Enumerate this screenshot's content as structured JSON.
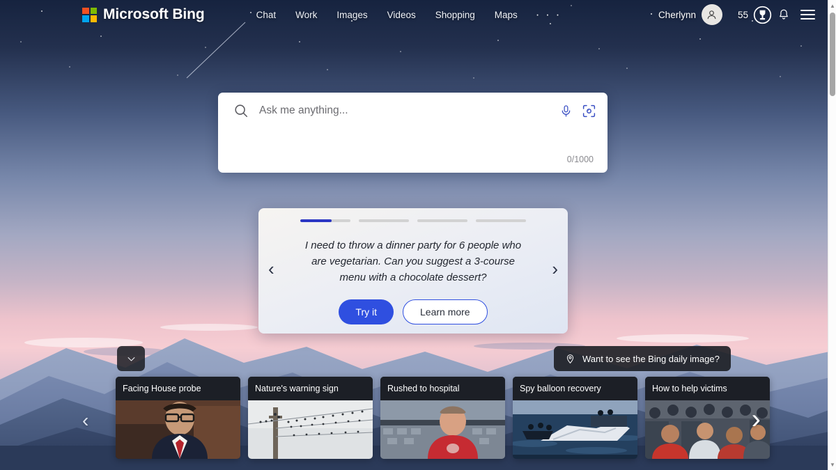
{
  "brand": {
    "name": "Microsoft Bing",
    "logo_icon": "microsoft-logo-icon",
    "colors": {
      "red": "#f25022",
      "green": "#7fba00",
      "blue": "#00a4ef",
      "yellow": "#ffb900"
    }
  },
  "nav": {
    "items": [
      {
        "label": "Chat"
      },
      {
        "label": "Work"
      },
      {
        "label": "Images"
      },
      {
        "label": "Videos"
      },
      {
        "label": "Shopping"
      },
      {
        "label": "Maps"
      }
    ],
    "more_label": "· · ·"
  },
  "account": {
    "username": "Cherlynn",
    "avatar_icon": "person-avatar-icon",
    "rewards_count": "55",
    "rewards_icon": "rewards-trophy-icon",
    "notifications_icon": "bell-icon",
    "menu_icon": "hamburger-menu-icon"
  },
  "search": {
    "placeholder": "Ask me anything...",
    "value": "",
    "counter": "0/1000",
    "search_icon": "search-icon",
    "mic_icon": "microphone-icon",
    "lens_icon": "visual-search-icon",
    "accent": "#3a4fc4"
  },
  "suggestion_card": {
    "progress": {
      "total": 4,
      "active_index": 0,
      "active_fill_percent": 62
    },
    "prompt": "I need to throw a dinner party for 6 people who are vegetarian. Can you suggest a 3-course menu with a chocolate dessert?",
    "primary_button": "Try it",
    "secondary_button": "Learn more",
    "prev_icon": "chevron-left-icon",
    "next_icon": "chevron-right-icon",
    "primary_color": "#2f4fe0"
  },
  "controls": {
    "expand_icon": "chevron-down-icon",
    "daily_image_label": "Want to see the Bing daily image?",
    "daily_image_icon": "location-pin-icon",
    "news_prev_icon": "chevron-left-icon",
    "news_next_icon": "chevron-right-icon"
  },
  "news": {
    "cards": [
      {
        "title": "Facing House probe",
        "image": "man-in-suit-red-tie"
      },
      {
        "title": "Nature's warning sign",
        "image": "birds-on-power-lines"
      },
      {
        "title": "Rushed to hospital",
        "image": "man-red-shirt-stadium"
      },
      {
        "title": "Spy balloon recovery",
        "image": "balloon-recovery-at-sea"
      },
      {
        "title": "How to help victims",
        "image": "crowd-of-people"
      }
    ]
  },
  "scrollbar": {
    "up_icon": "scroll-up-arrow-icon",
    "down_icon": "scroll-down-arrow-icon"
  }
}
